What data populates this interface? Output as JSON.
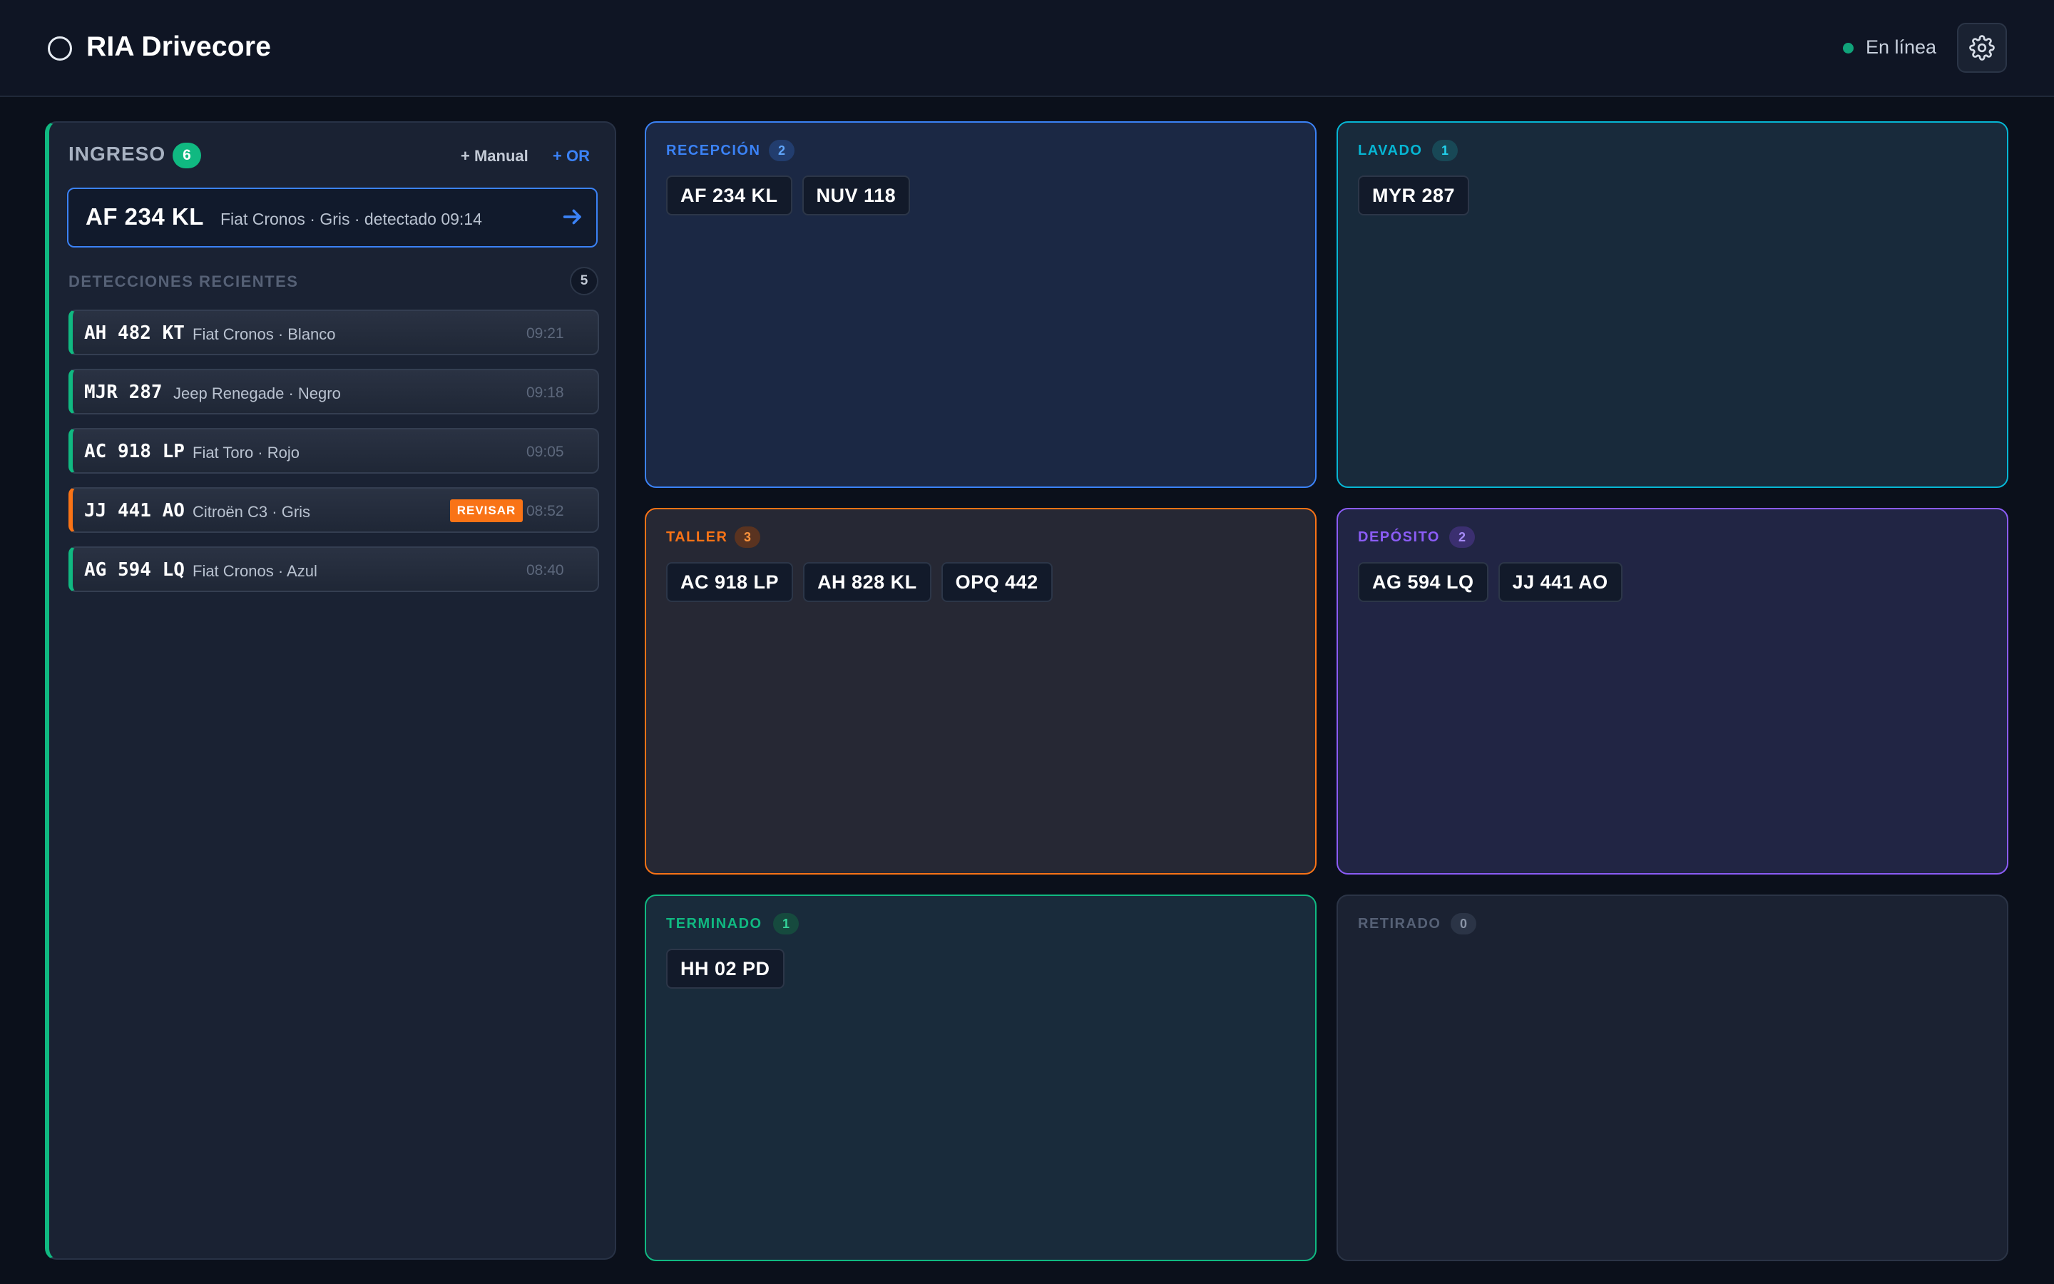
{
  "app": {
    "title": "RIA Drivecore"
  },
  "status": {
    "label": "En línea",
    "color": "#10a37a"
  },
  "settings": {
    "icon": "gear-icon"
  },
  "ingreso": {
    "title": "INGRESO",
    "count": "6",
    "manual_label": "+ Manual",
    "or_label": "+ OR",
    "featured": {
      "plate": "AF 234 KL",
      "description": "Fiat Cronos · Gris · detectado 09:14",
      "icon": "arrow-right-icon"
    },
    "recent_title": "DETECCIONES RECIENTES",
    "recent_count": "5",
    "detections": [
      {
        "plate": "AH 482 KT",
        "description": "Fiat Cronos · Blanco",
        "time": "09:21",
        "flag": ""
      },
      {
        "plate": "MJR 287",
        "description": "Jeep Renegade · Negro",
        "time": "09:18",
        "flag": ""
      },
      {
        "plate": "AC 918 LP",
        "description": "Fiat Toro · Rojo",
        "time": "09:05",
        "flag": ""
      },
      {
        "plate": "JJ 441 AO",
        "description": "Citroën C3 · Gris",
        "time": "08:52",
        "flag": "REVISAR"
      },
      {
        "plate": "AG 594 LQ",
        "description": "Fiat Cronos · Azul",
        "time": "08:40",
        "flag": ""
      }
    ]
  },
  "stages": {
    "recepcion": {
      "title": "RECEPCIÓN",
      "count": "2",
      "color": "#3b82f6",
      "plates": [
        "AF 234 KL",
        "NUV 118"
      ]
    },
    "lavado": {
      "title": "LAVADO",
      "count": "1",
      "color": "#06b6d4",
      "plates": [
        "MYR 287"
      ]
    },
    "taller": {
      "title": "TALLER",
      "count": "3",
      "color": "#f97316",
      "plates": [
        "AC 918 LP",
        "AH 828 KL",
        "OPQ 442"
      ]
    },
    "deposito": {
      "title": "DEPÓSITO",
      "count": "2",
      "color": "#8b5cf6",
      "plates": [
        "AG 594 LQ",
        "JJ 441 AO"
      ]
    },
    "terminado": {
      "title": "TERMINADO",
      "count": "1",
      "color": "#10b981",
      "plates": [
        "HH 02 PD"
      ]
    },
    "retirado": {
      "title": "RETIRADO",
      "count": "0",
      "color": "#566176",
      "plates": []
    }
  },
  "colors": {
    "accent_green": "#10b981",
    "accent_blue": "#3b82f6",
    "warning": "#f97316"
  }
}
